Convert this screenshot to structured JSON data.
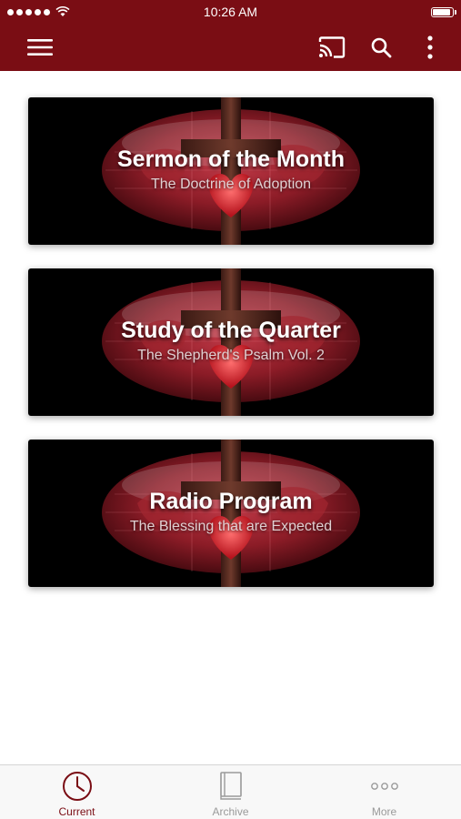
{
  "status_bar": {
    "time": "10:26 AM",
    "battery_level": 0.9
  },
  "app_bar": {
    "icons": [
      "menu-icon",
      "cast-icon",
      "search-icon",
      "more-vertical-icon"
    ]
  },
  "cards": [
    {
      "title": "Sermon of the Month",
      "subtitle": "The Doctrine of Adoption"
    },
    {
      "title": "Study of the Quarter",
      "subtitle": "The Shepherd's Psalm Vol. 2"
    },
    {
      "title": "Radio Program",
      "subtitle": "The Blessing that are Expected"
    }
  ],
  "tab_bar": {
    "tabs": [
      {
        "label": "Current",
        "icon": "clock-icon",
        "selected": true
      },
      {
        "label": "Archive",
        "icon": "book-icon",
        "selected": false
      },
      {
        "label": "More",
        "icon": "more-horizontal-icon",
        "selected": false
      }
    ]
  },
  "colors": {
    "brand": "#7a0d14",
    "tab_selected": "#7a0d14",
    "tab_unselected": "#9a9a9a"
  }
}
